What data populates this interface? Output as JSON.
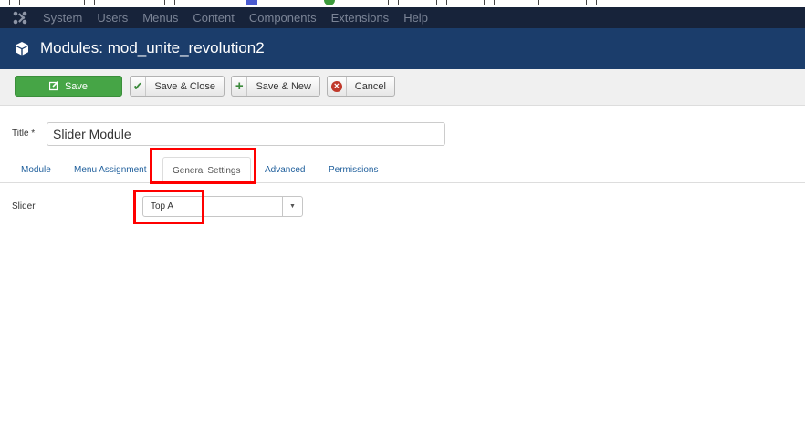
{
  "navbar": {
    "items": [
      "System",
      "Users",
      "Menus",
      "Content",
      "Components",
      "Extensions",
      "Help"
    ]
  },
  "titlebar": {
    "title": "Modules: mod_unite_revolution2"
  },
  "toolbar": {
    "save_label": "Save",
    "save_close_label": "Save & Close",
    "save_new_label": "Save & New",
    "cancel_label": "Cancel"
  },
  "form": {
    "title_label": "Title *",
    "title_value": "Slider Module",
    "slider_label": "Slider",
    "slider_value": "Top A"
  },
  "tabs": [
    {
      "label": "Module"
    },
    {
      "label": "Menu Assignment"
    },
    {
      "label": "General Settings",
      "active": true
    },
    {
      "label": "Advanced"
    },
    {
      "label": "Permissions"
    }
  ],
  "colors": {
    "navbar_bg": "#17233a",
    "titlebar_bg": "#1b3d6b",
    "save_green": "#46a546",
    "highlight_red": "#ff0000",
    "tab_link": "#1f5f9c"
  },
  "icons": [
    "joomla-logo-icon",
    "cube-icon",
    "edit-icon",
    "check-icon",
    "plus-icon",
    "cancel-icon",
    "caret-down-icon"
  ]
}
